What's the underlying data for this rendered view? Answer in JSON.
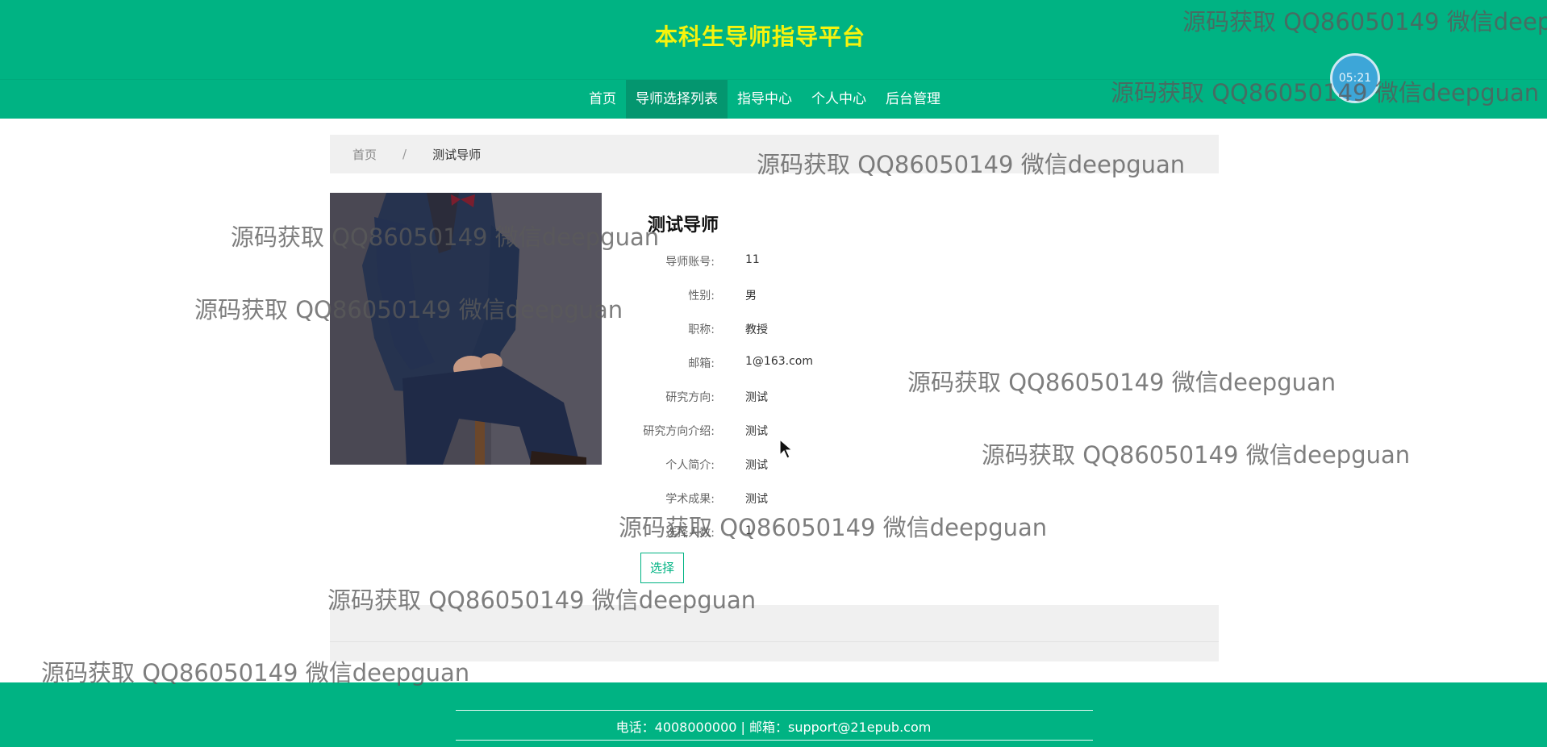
{
  "header": {
    "site_title": "本科生导师指导平台"
  },
  "nav": {
    "items": [
      {
        "label": "首页"
      },
      {
        "label": "导师选择列表"
      },
      {
        "label": "指导中心"
      },
      {
        "label": "个人中心"
      },
      {
        "label": "后台管理"
      }
    ],
    "active_index": 1
  },
  "timer": {
    "text": "05:21"
  },
  "breadcrumb": {
    "home": "首页",
    "separator": "/",
    "current": "测试导师"
  },
  "detail": {
    "name": "测试导师",
    "fields": [
      {
        "label": "导师账号:",
        "value": "11"
      },
      {
        "label": "性别:",
        "value": "男"
      },
      {
        "label": "职称:",
        "value": "教授"
      },
      {
        "label": "邮箱:",
        "value": "1@163.com"
      },
      {
        "label": "研究方向:",
        "value": "测试"
      },
      {
        "label": "研究方向介绍:",
        "value": "测试"
      },
      {
        "label": "个人简介:",
        "value": "测试"
      },
      {
        "label": "学术成果:",
        "value": "测试"
      },
      {
        "label": "选择人数:",
        "value": "1"
      }
    ],
    "select_button": "选择"
  },
  "footer": {
    "text": "电话：4008000000 | 邮箱：support@21epub.com"
  },
  "watermark": {
    "text": "源码获取 QQ86050149 微信deepguan",
    "text_truncated": "源码获取 QQ86050149 微信deep"
  },
  "colors": {
    "primary": "#00b383",
    "nav_active": "#04966f",
    "title": "#f7f30d",
    "timer": "#3da6d8"
  }
}
